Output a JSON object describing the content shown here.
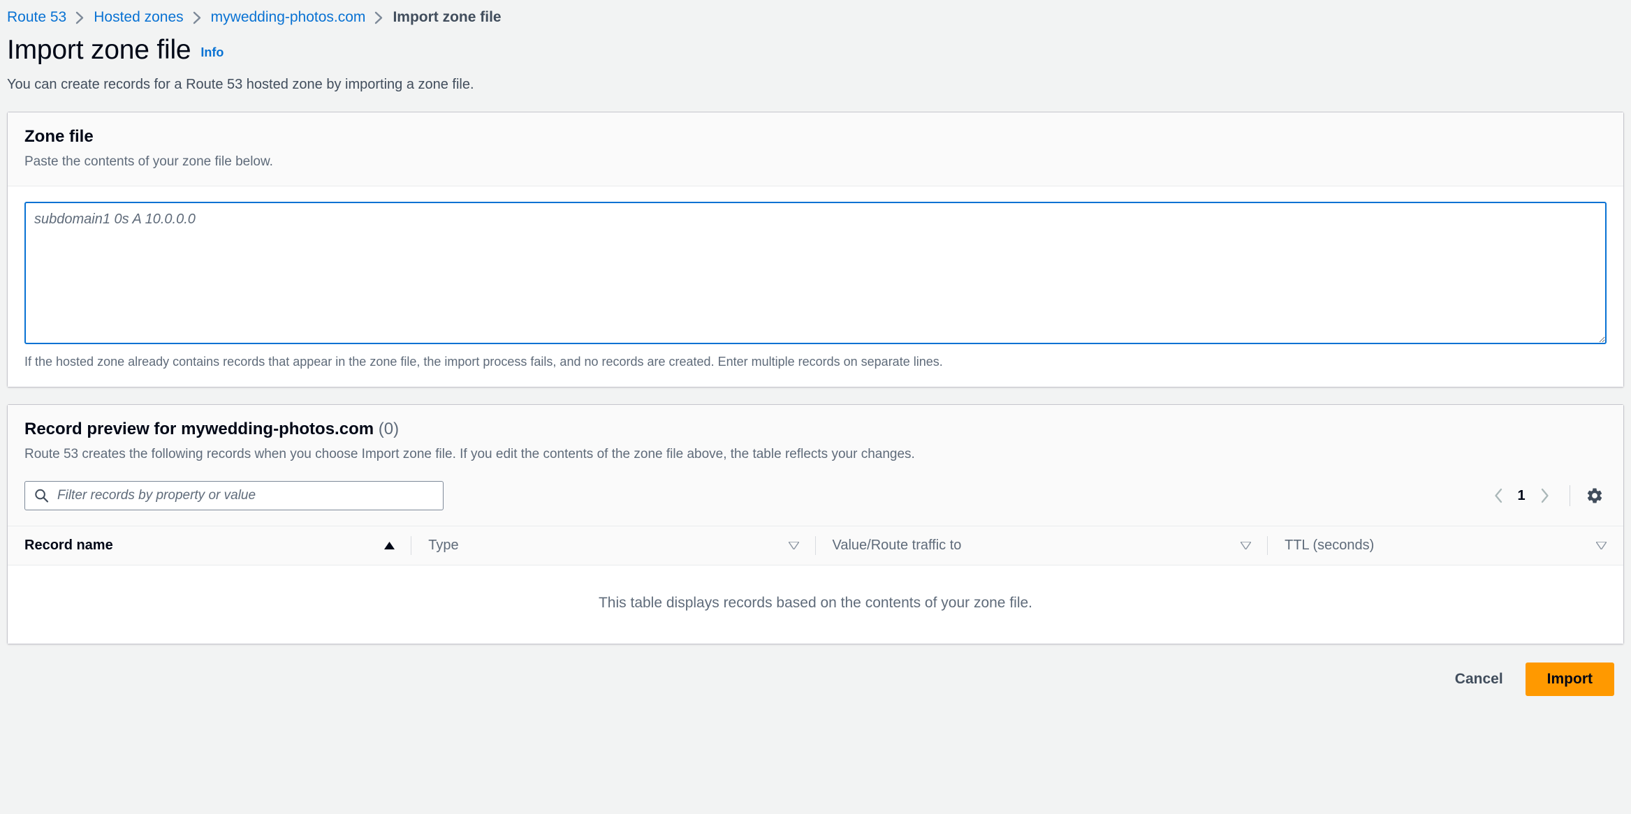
{
  "breadcrumb": {
    "items": [
      {
        "label": "Route 53",
        "current": false
      },
      {
        "label": "Hosted zones",
        "current": false
      },
      {
        "label": "mywedding-photos.com",
        "current": false
      },
      {
        "label": "Import zone file",
        "current": true
      }
    ]
  },
  "header": {
    "title": "Import zone file",
    "info_label": "Info",
    "description": "You can create records for a Route 53 hosted zone by importing a zone file."
  },
  "zone_file": {
    "title": "Zone file",
    "subtitle": "Paste the contents of your zone file below.",
    "textarea_value": "",
    "textarea_placeholder": "subdomain1 0s A 10.0.0.0",
    "hint": "If the hosted zone already contains records that appear in the zone file, the import process fails, and no records are created. Enter multiple records on separate lines."
  },
  "record_preview": {
    "title": "Record preview for mywedding-photos.com",
    "count": "(0)",
    "subtitle": "Route 53 creates the following records when you choose Import zone file. If you edit the contents of the zone file above, the table reflects your changes.",
    "filter_value": "",
    "filter_placeholder": "Filter records by property or value",
    "pagination": {
      "prev_icon": "chevron-left-icon",
      "page_number": "1",
      "next_icon": "chevron-right-icon",
      "settings_icon": "gear-icon"
    },
    "columns": [
      {
        "label": "Record name",
        "sorted": true,
        "sort_dir": "asc"
      },
      {
        "label": "Type",
        "sorted": false,
        "sort_dir": "desc"
      },
      {
        "label": "Value/Route traffic to",
        "sorted": false,
        "sort_dir": "desc"
      },
      {
        "label": "TTL (seconds)",
        "sorted": false,
        "sort_dir": "desc"
      }
    ],
    "rows": [],
    "empty_message": "This table displays records based on the contents of your zone file."
  },
  "footer": {
    "cancel_label": "Cancel",
    "import_label": "Import"
  },
  "colors": {
    "link": "#0972d3",
    "accent_orange": "#ff9900",
    "page_background": "#f2f3f3",
    "card_background": "#ffffff",
    "header_background": "#fafafa",
    "text_primary": "#000716",
    "text_secondary": "#5f6b7a",
    "focus_border": "#0972d3"
  }
}
